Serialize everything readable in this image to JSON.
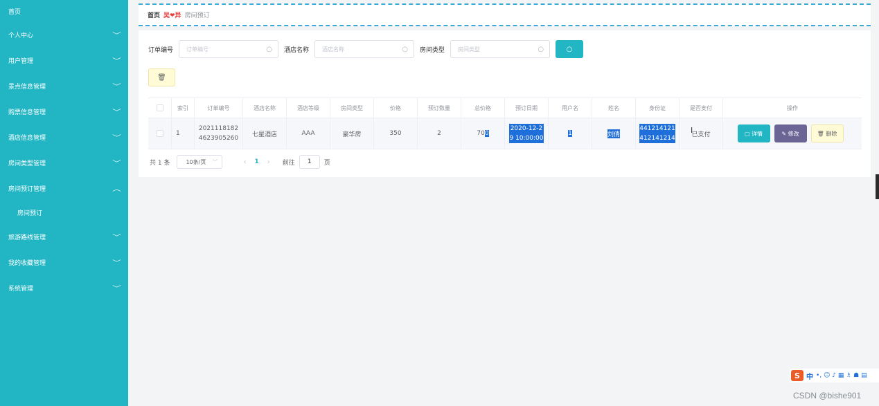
{
  "sidebar": {
    "items": [
      {
        "label": "首页",
        "chevron": false
      },
      {
        "label": "个人中心",
        "chevron": "down"
      },
      {
        "label": "用户管理",
        "chevron": "down"
      },
      {
        "label": "景点信息管理",
        "chevron": "down"
      },
      {
        "label": "购票信息管理",
        "chevron": "down"
      },
      {
        "label": "酒店信息管理",
        "chevron": "down"
      },
      {
        "label": "房间类型管理",
        "chevron": "down"
      },
      {
        "label": "房间预订管理",
        "chevron": "up"
      },
      {
        "label": "房间预订",
        "sub": true
      },
      {
        "label": "旅游路线管理",
        "chevron": "down"
      },
      {
        "label": "我的收藏管理",
        "chevron": "down"
      },
      {
        "label": "系统管理",
        "chevron": "down"
      }
    ]
  },
  "breadcrumb": {
    "home": "首页",
    "separator": "吴❤异",
    "current": "房间预订"
  },
  "filters": {
    "order_no": {
      "label": "订单编号",
      "placeholder": "订单编号"
    },
    "hotel_name": {
      "label": "酒店名称",
      "placeholder": "酒店名称"
    },
    "room_type": {
      "label": "房间类型",
      "placeholder": "房间类型"
    }
  },
  "table": {
    "headers": [
      "索引",
      "订单编号",
      "酒店名称",
      "酒店等级",
      "房间类型",
      "价格",
      "预订数量",
      "总价格",
      "预订日期",
      "用户名",
      "姓名",
      "身份证",
      "是否支付",
      "操作"
    ],
    "rows": [
      {
        "index": "1",
        "order_no_1": "2021118182",
        "order_no_2": "4623905260",
        "hotel_name": "七星酒店",
        "hotel_level": "AAA",
        "room_type": "豪华房",
        "price": "350",
        "quantity": "2",
        "total_a": "70",
        "total_b": "0",
        "date_1": "2020-12-2",
        "date_2": "9 10:00:00",
        "username": "1",
        "name": "刘倩",
        "id_1": "441214121",
        "id_2": "412141214",
        "paid": "已支付",
        "actions": {
          "detail": "详情",
          "edit": "修改",
          "delete": "删除"
        }
      }
    ]
  },
  "pagination": {
    "total": "共 1 条",
    "page_size": "10条/页",
    "current": "1",
    "jump_label": "前往",
    "jump_value": "1",
    "page_suffix": "页"
  },
  "ime": {
    "logo": "S",
    "lang": "中",
    "icons": "•, ☺ ♪ ▦ ♗ ☗ ▤"
  },
  "watermark": "CSDN @bishe901",
  "colors": {
    "accent": "#22b5c3",
    "edit": "#6b6596",
    "delete_bg": "#fffbd6",
    "selection": "#1e6fd9"
  }
}
